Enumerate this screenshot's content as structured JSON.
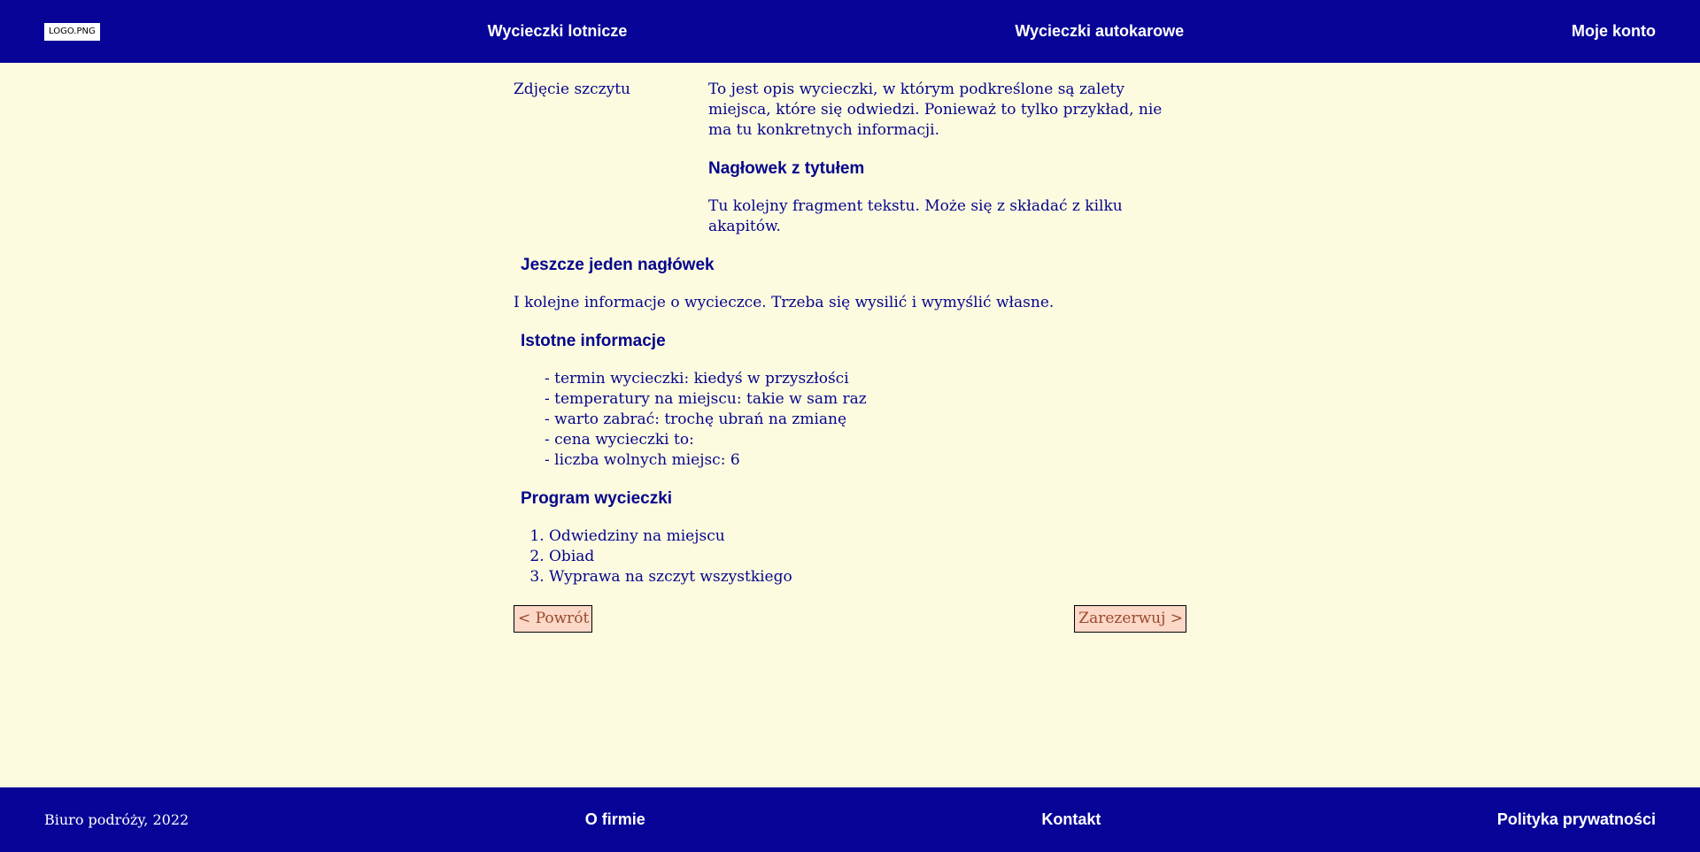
{
  "header": {
    "logo": "LOGO.PNG",
    "nav": [
      "Wycieczki lotnicze",
      "Wycieczki autokarowe",
      "Moje konto"
    ]
  },
  "main": {
    "photo_placeholder": "Zdjęcie szczytu",
    "description": "To jest opis wycieczki, w którym podkreślone są zalety miejsca, które się odwiedzi. Ponieważ to tylko przykład, nie ma tu konkretnych informacji.",
    "heading1": "Nagłowek z tytułem",
    "paragraph1": "Tu kolejny fragment tekstu. Może się z składać z kilku akapitów.",
    "heading2": "Jeszcze jeden nagłówek",
    "paragraph2": "I kolejne informacje o wycieczce. Trzeba się wysilić i wymyślić własne.",
    "heading3": "Istotne informacje",
    "info": [
      "- termin wycieczki: kiedyś w przyszłości",
      "- temperatury na miejscu: takie w sam raz",
      "- warto zabrać: trochę ubrań na zmianę",
      "- cena wycieczki to:",
      "- liczba wolnych miejsc: 6"
    ],
    "heading4": "Program wycieczki",
    "program": [
      "Odwiedziny na miejscu",
      "Obiad",
      "Wyprawa na szczyt wszystkiego"
    ],
    "back_button": "< Powrót",
    "book_button": "Zarezerwuj >"
  },
  "footer": {
    "copyright": "Biuro podróży, 2022",
    "links": [
      "O firmie",
      "Kontakt",
      "Polityka prywatności"
    ]
  },
  "colors": {
    "navbar": "#070497",
    "background": "#fdfbdf",
    "text": "#05058c",
    "button_bg": "#fbd8c8",
    "button_text": "#9a4a2a"
  }
}
